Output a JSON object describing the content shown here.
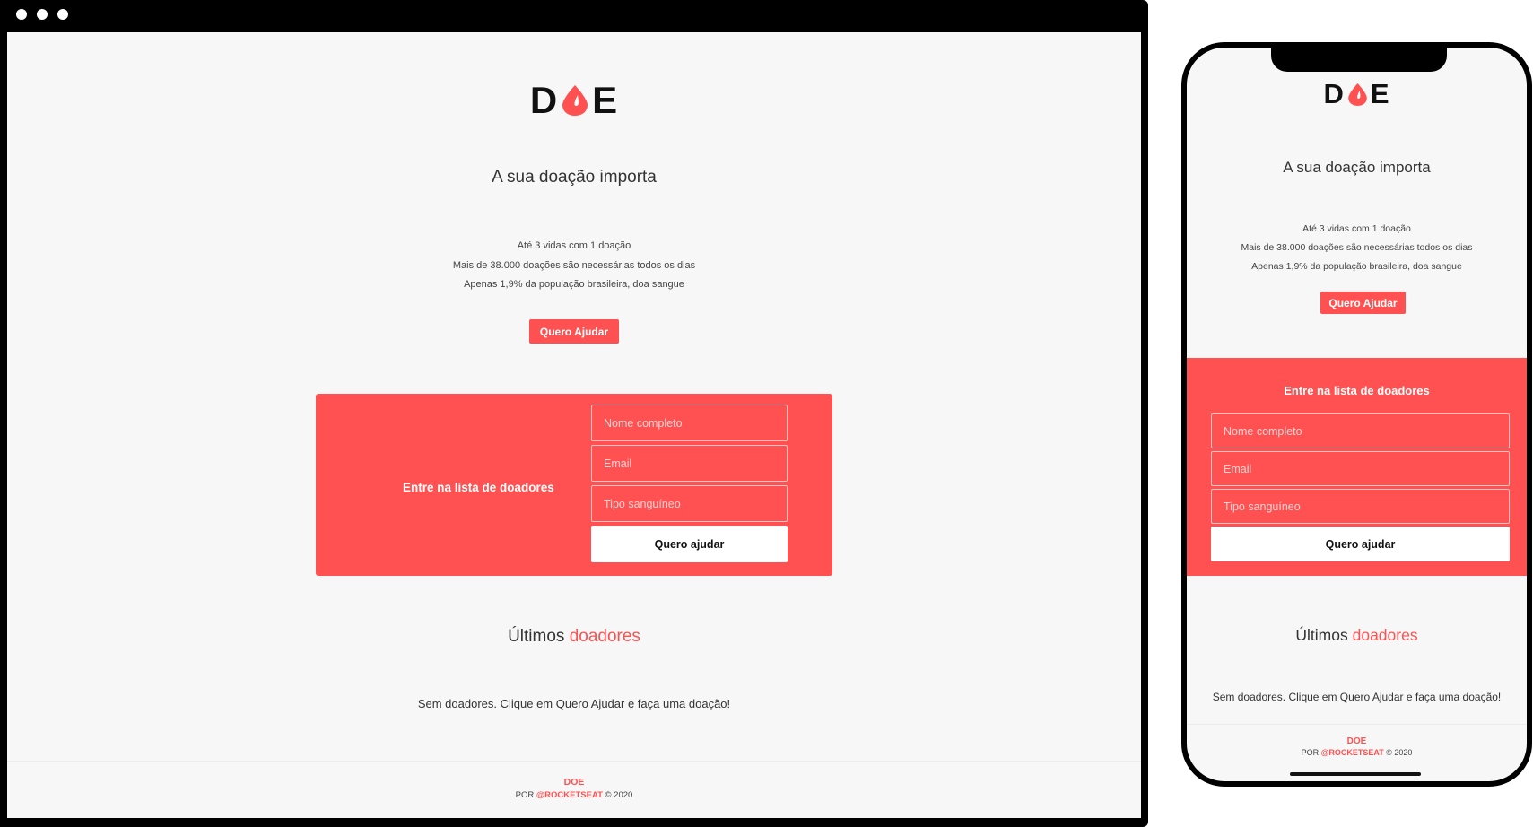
{
  "brand": {
    "logo_left": "D",
    "logo_right": "E",
    "drop_icon": "blood-drop-icon",
    "accent_color": "#ff5151"
  },
  "hero": {
    "title": "A sua doação importa",
    "stats": [
      "Até 3 vidas com 1 doação",
      "Mais de 38.000 doações são necessárias todos os dias",
      "Apenas 1,9% da população brasileira, doa sangue"
    ],
    "cta_label": "Quero Ajudar"
  },
  "form": {
    "title": "Entre na lista de doadores",
    "fields": [
      {
        "placeholder": "Nome completo"
      },
      {
        "placeholder": "Email"
      },
      {
        "placeholder": "Tipo sanguíneo"
      }
    ],
    "submit_label": "Quero ajudar"
  },
  "donors": {
    "title_prefix": "Últimos",
    "title_highlight": "doadores",
    "empty_message": "Sem doadores. Clique em Quero Ajudar e faça uma doação!"
  },
  "footer": {
    "brand": "DOE",
    "by": "POR",
    "handle": "@ROCKETSEAT",
    "copyright": "© 2020"
  }
}
